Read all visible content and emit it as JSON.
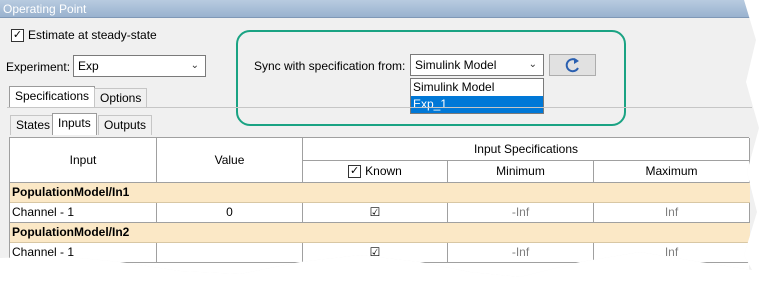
{
  "window": {
    "title": "Operating Point"
  },
  "estimate": {
    "label": "Estimate at steady-state",
    "checked": "☑"
  },
  "experiment": {
    "label": "Experiment:",
    "value": "Exp"
  },
  "sync": {
    "label": "Sync with specification from:",
    "value": "Simulink Model",
    "options": [
      "Simulink Model",
      "Exp_1"
    ],
    "selected_index": 1
  },
  "tabs": {
    "specifications": "Specifications",
    "options": "Options"
  },
  "subtabs": {
    "states": "States",
    "inputs": "Inputs",
    "outputs": "Outputs"
  },
  "table": {
    "headers": {
      "input": "Input",
      "value": "Value",
      "input_specs": "Input Specifications",
      "known": "Known",
      "minimum": "Minimum",
      "maximum": "Maximum"
    },
    "groups": [
      {
        "name": "PopulationModel/In1",
        "rows": [
          {
            "input": "Channel - 1",
            "value": "0",
            "known": "☑",
            "min": "-Inf",
            "max": "Inf"
          }
        ]
      },
      {
        "name": "PopulationModel/In2",
        "rows": [
          {
            "input": "Channel - 1",
            "value": "",
            "known": "☑",
            "min": "-Inf",
            "max": "Inf"
          }
        ]
      }
    ]
  },
  "colors": {
    "accent": "#1aa383",
    "group_bg": "#fbe8c6",
    "selection": "#0078d7"
  },
  "icons": {
    "check": "☑",
    "chevron": "⌄",
    "refresh": "refresh-icon"
  }
}
